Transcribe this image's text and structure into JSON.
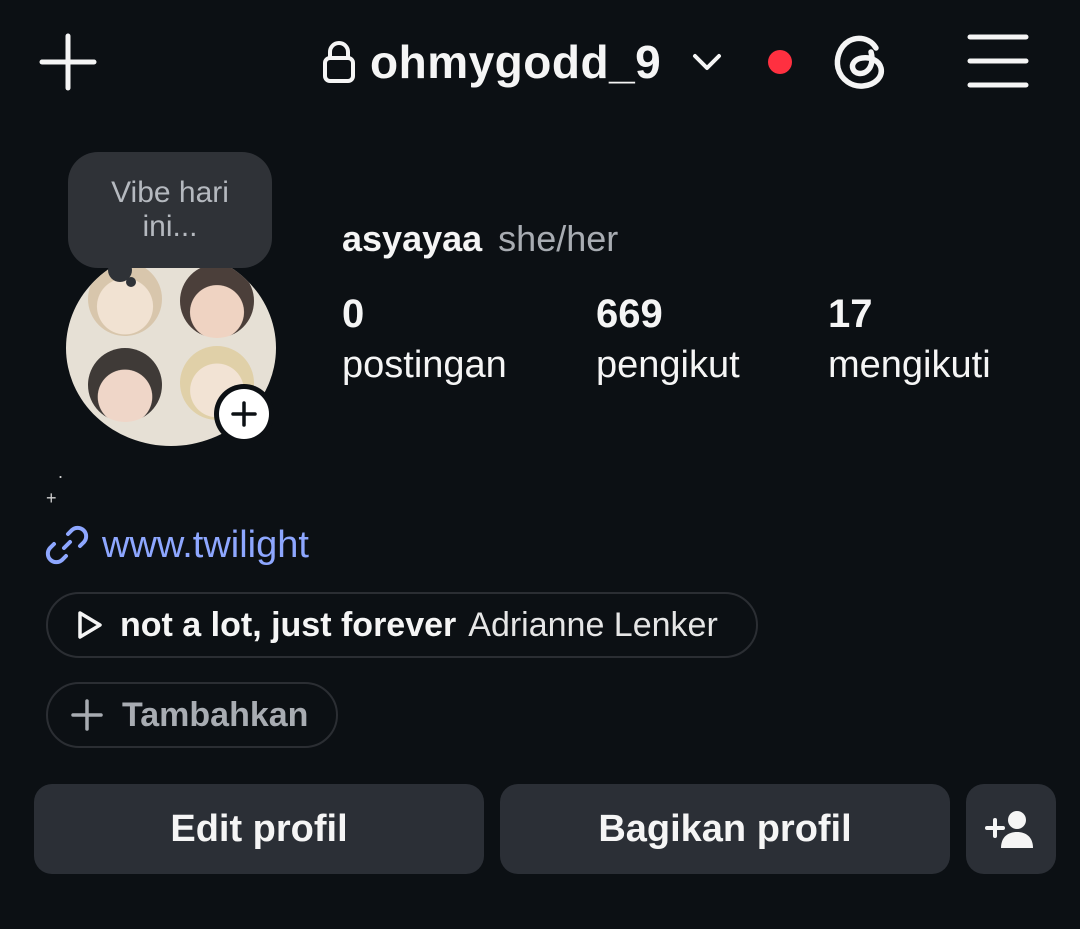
{
  "header": {
    "username": "ohmygodd_9",
    "notification_color": "#ff3040",
    "icons": {
      "create": "plus-icon",
      "lock": "lock-icon",
      "switch_account": "chevron-down-icon",
      "threads": "threads-icon",
      "menu": "hamburger-menu-icon"
    }
  },
  "profile": {
    "note_text": "Vibe hari ini...",
    "display_name": "asyayaa",
    "pronouns": "she/her",
    "stats": [
      {
        "value": "0",
        "label": "postingan"
      },
      {
        "value": "669",
        "label": "pengikut"
      },
      {
        "value": "17",
        "label": "mengikuti"
      }
    ],
    "bio_line1": ".",
    "bio_line2": "+",
    "link": "www.twilight",
    "link_color": "#8ea7ff"
  },
  "music": {
    "song": "not a lot, just forever",
    "artist": "Adrianne Lenker"
  },
  "add_pill": {
    "label": "Tambahkan"
  },
  "actions": {
    "edit_label": "Edit profil",
    "share_label": "Bagikan profil",
    "discover_icon": "add-person-icon"
  }
}
